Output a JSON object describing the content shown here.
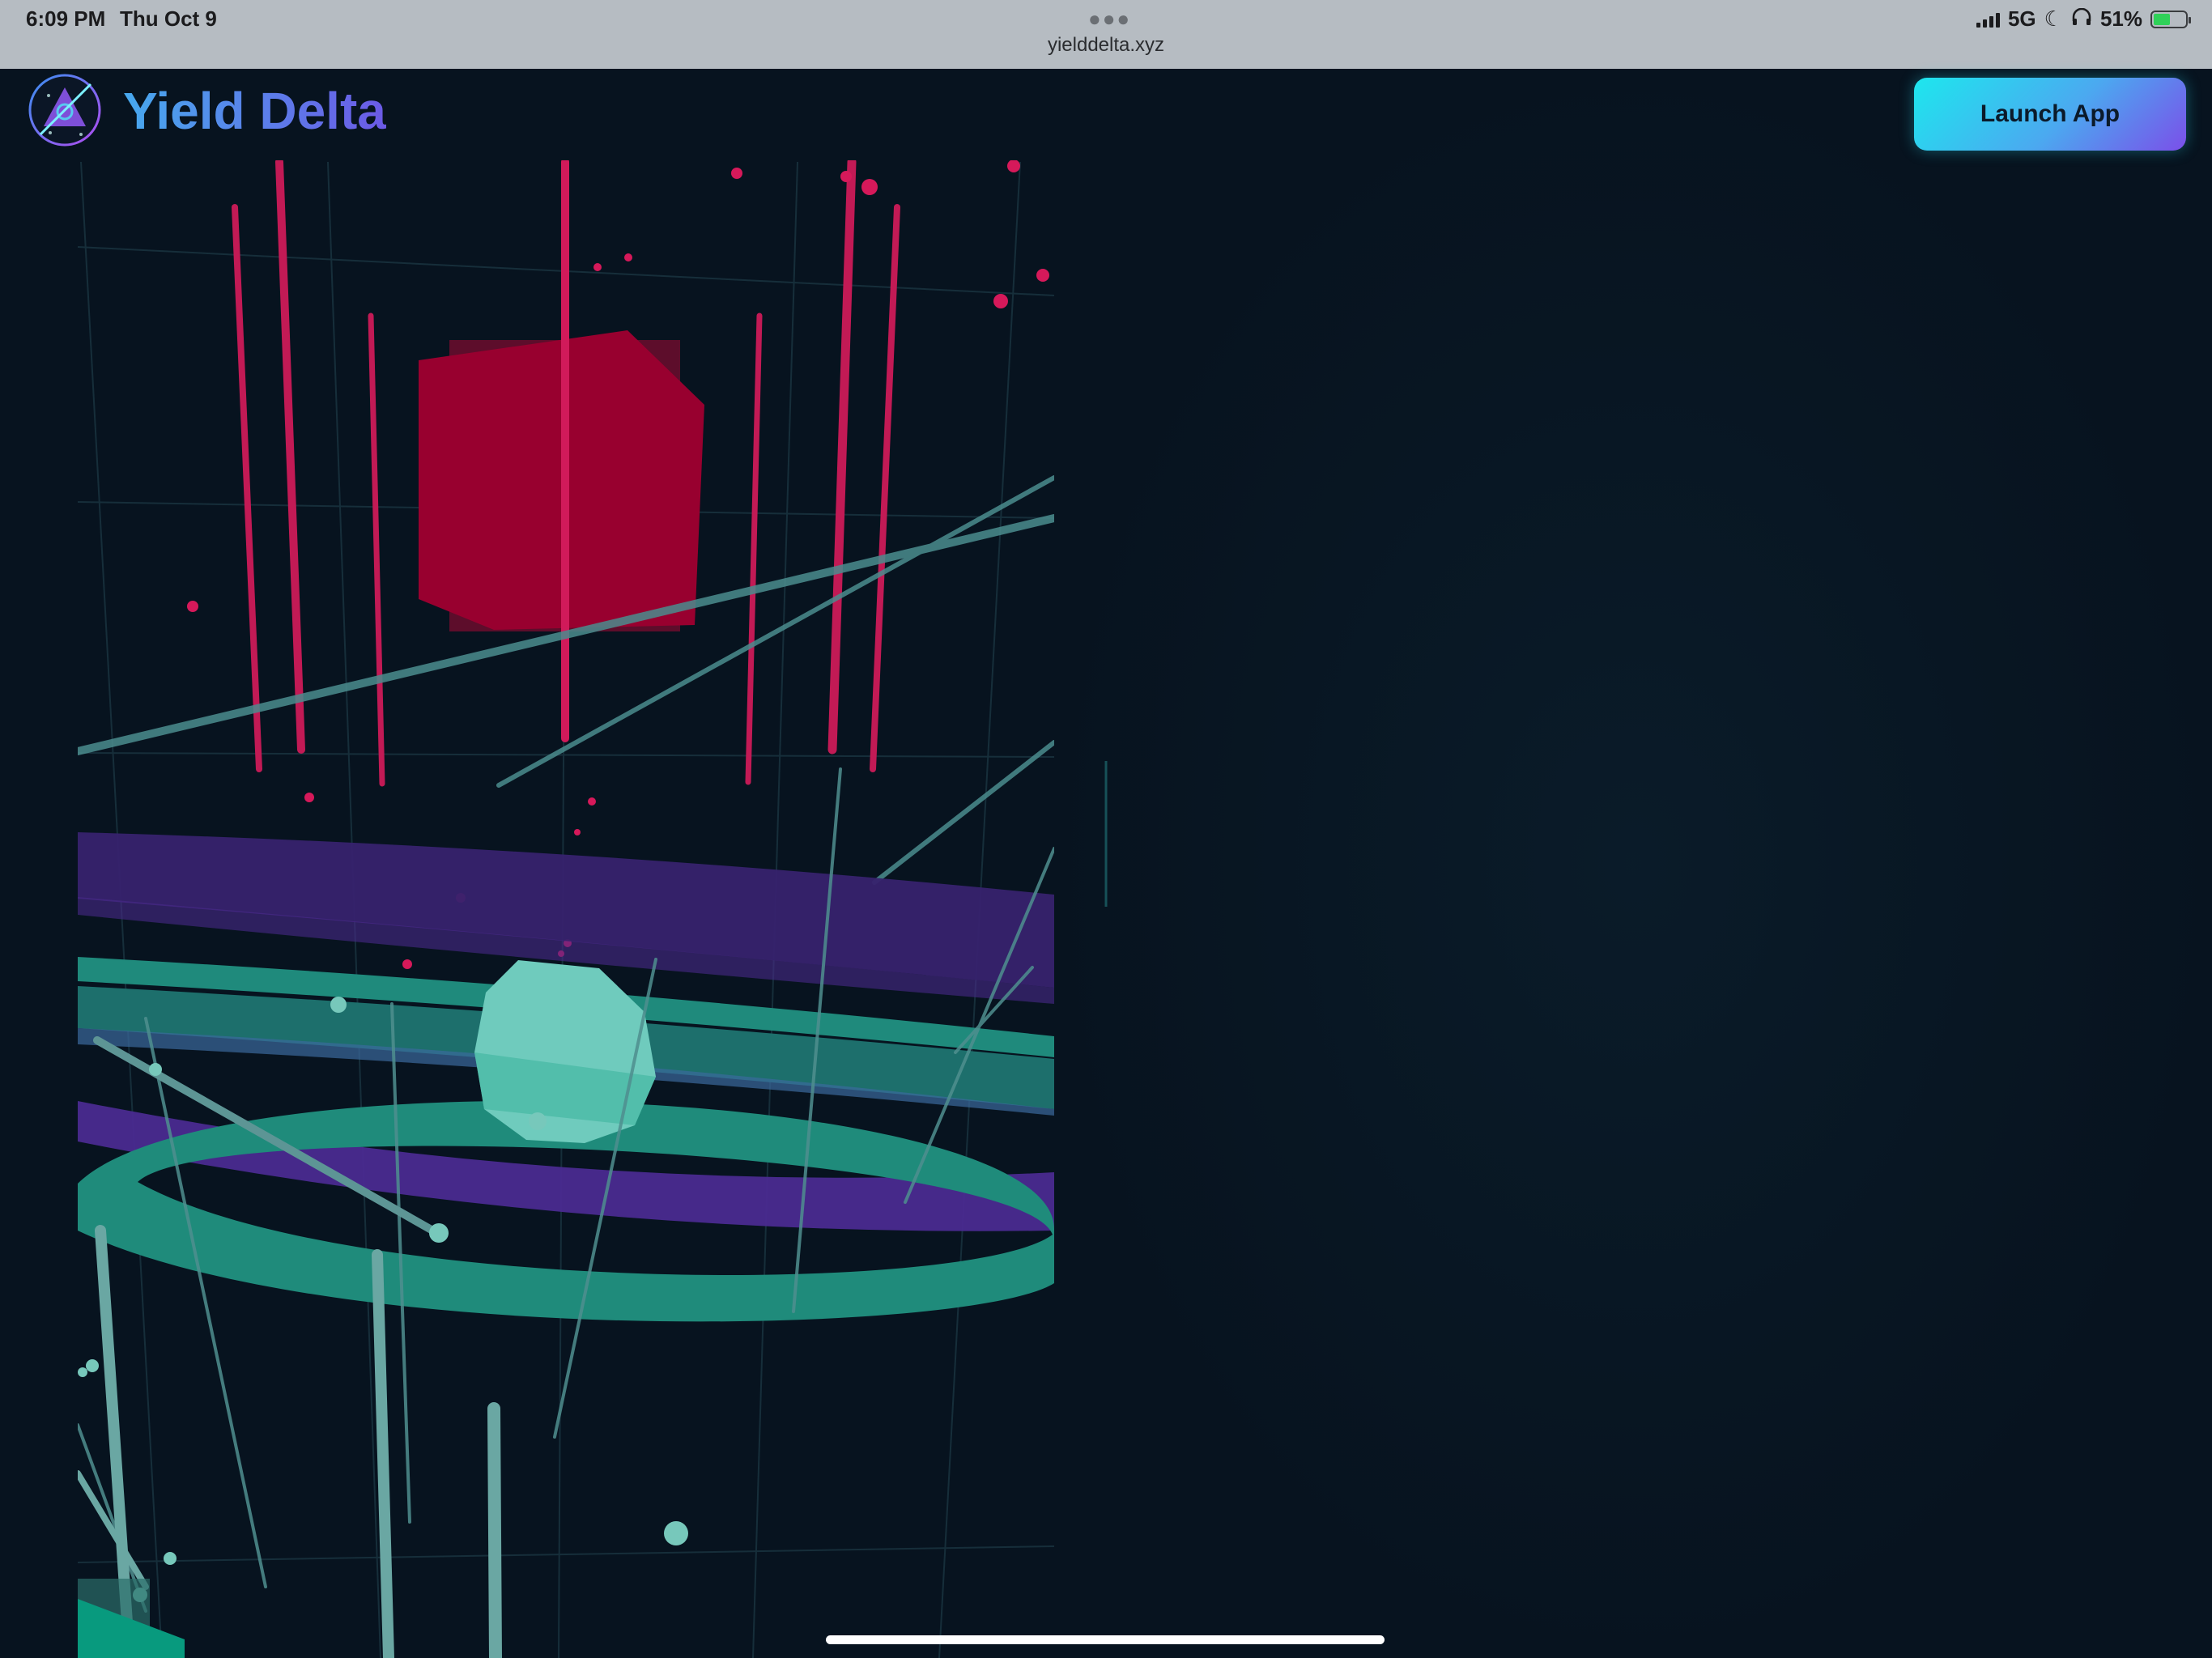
{
  "status_bar": {
    "time": "6:09 PM",
    "date": "Thu Oct 9",
    "url": "yielddelta.xyz",
    "network": "5G",
    "battery": "51%",
    "more_icon": "ellipsis-icon"
  },
  "header": {
    "brand": "Yield Delta",
    "launch_label": "Launch App",
    "logo_icon": "yield-delta-logo-icon"
  },
  "colors": {
    "page_bg": "#07131f",
    "brand_gradient": [
      "#47a9ee",
      "#6c5ae6"
    ],
    "button_gradient": [
      "#1de7ee",
      "#7b4fe9"
    ],
    "scene_red": "#d6195a",
    "scene_teal": "#2ab39a",
    "scene_purple": "#4a2a8a"
  }
}
